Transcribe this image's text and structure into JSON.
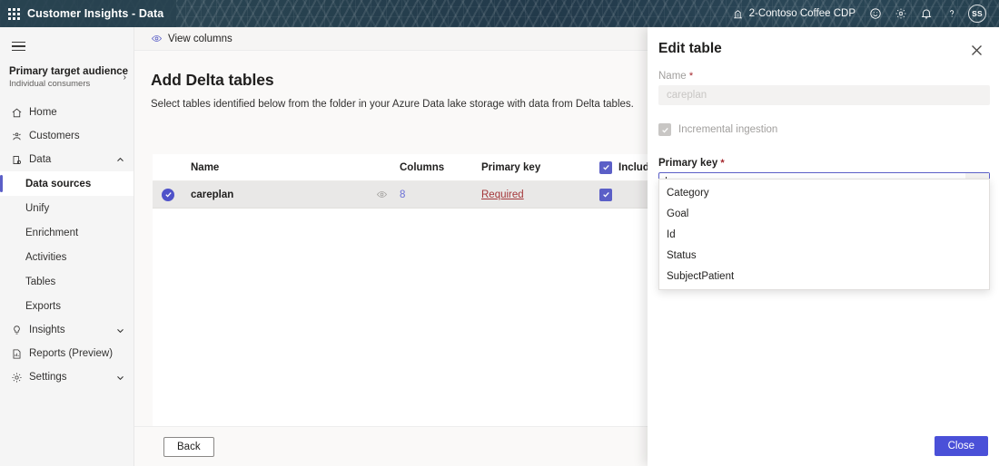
{
  "header": {
    "app_title": "Customer Insights - Data",
    "waffle_icon": "app-launcher-icon",
    "environment": "2-Contoso Coffee CDP",
    "environment_icon": "environment-icon",
    "feedback_icon": "smiley-feedback-icon",
    "settings_icon": "gear-icon",
    "notifications_icon": "bell-icon",
    "help_icon": "question-help-icon",
    "avatar_initials": "SS",
    "bg_color": "#27414f"
  },
  "sidebar": {
    "menu_icon": "hamburger-menu-icon",
    "audience": {
      "title": "Primary target audience",
      "subtitle": "Individual consumers",
      "chevron": "›"
    },
    "items": [
      {
        "label": "Home",
        "icon": "home-icon",
        "level": "top",
        "active": false,
        "expandable": false
      },
      {
        "label": "Customers",
        "icon": "customers-icon",
        "level": "top",
        "active": false,
        "expandable": false
      },
      {
        "label": "Data",
        "icon": "data-icon",
        "level": "top",
        "active": false,
        "expandable": true,
        "expanded": true
      },
      {
        "label": "Data sources",
        "icon": "",
        "level": "sub",
        "active": true,
        "expandable": false
      },
      {
        "label": "Unify",
        "icon": "",
        "level": "sub",
        "active": false,
        "expandable": false
      },
      {
        "label": "Enrichment",
        "icon": "",
        "level": "sub",
        "active": false,
        "expandable": false
      },
      {
        "label": "Activities",
        "icon": "",
        "level": "sub",
        "active": false,
        "expandable": false
      },
      {
        "label": "Tables",
        "icon": "",
        "level": "sub",
        "active": false,
        "expandable": false
      },
      {
        "label": "Exports",
        "icon": "",
        "level": "sub",
        "active": false,
        "expandable": false
      },
      {
        "label": "Insights",
        "icon": "lightbulb-icon",
        "level": "top",
        "active": false,
        "expandable": true,
        "expanded": false
      },
      {
        "label": "Reports (Preview)",
        "icon": "report-icon",
        "level": "top",
        "active": false,
        "expandable": false
      },
      {
        "label": "Settings",
        "icon": "gear-icon",
        "level": "top",
        "active": false,
        "expandable": true,
        "expanded": false
      }
    ]
  },
  "main": {
    "command_bar": {
      "view_columns_label": "View columns",
      "view_columns_icon": "eye-icon"
    },
    "page_title": "Add Delta tables",
    "page_subtitle": "Select tables identified below from the folder in your Azure Data lake storage with data from Delta tables.",
    "table": {
      "columns": [
        "Name",
        "Columns",
        "Primary key",
        "Include"
      ],
      "include_info_icon": "info-icon",
      "include_header_checked": true,
      "rows": [
        {
          "selected": true,
          "name": "careplan",
          "preview_icon": "eye-icon",
          "columns_count": "8",
          "primary_key": "Required",
          "include_checked": true
        }
      ]
    },
    "back_button": "Back"
  },
  "panel": {
    "title": "Edit table",
    "close_icon": "close-icon",
    "name_label": "Name",
    "name_required_marker": "*",
    "name_value": "careplan",
    "incremental_label": "Incremental ingestion",
    "incremental_checked": true,
    "primary_key_label": "Primary key",
    "primary_key_required_marker": "*",
    "primary_key_value": "",
    "primary_key_chevron_icon": "chevron-down-icon",
    "dropdown_options": [
      "Category",
      "Goal",
      "Id",
      "Status",
      "SubjectPatient"
    ],
    "close_button": "Close",
    "accent_color": "#4a50d8"
  }
}
